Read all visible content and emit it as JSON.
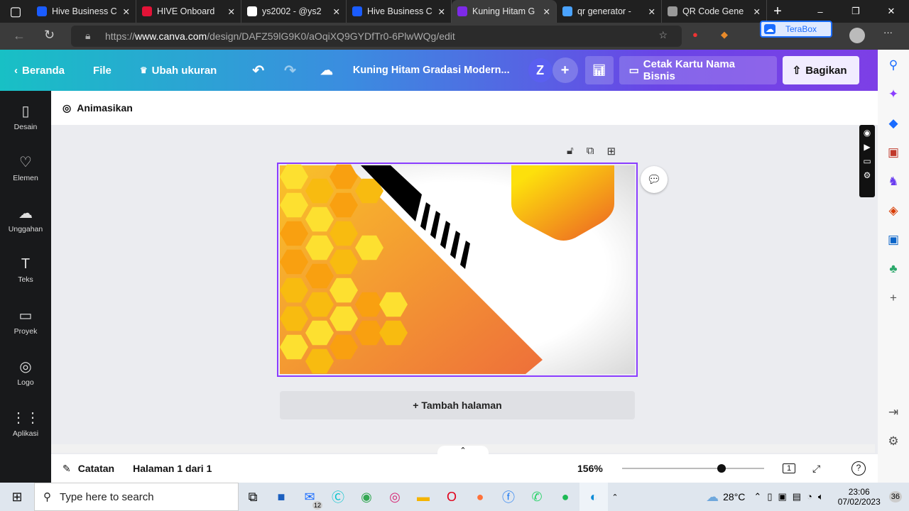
{
  "browser": {
    "tabs": [
      {
        "title": "Hive Business C",
        "color": "#1a5cff"
      },
      {
        "title": "HIVE Onboard",
        "color": "#e31337"
      },
      {
        "title": "ys2002 - @ys2",
        "color": "#ffffff"
      },
      {
        "title": "Hive Business C",
        "color": "#1a5cff"
      },
      {
        "title": "Kuning Hitam G",
        "color": "#7d2ae8",
        "active": true
      },
      {
        "title": "qr generator -",
        "color": "#4aa3ff"
      },
      {
        "title": "QR Code Gene",
        "color": "#999999"
      }
    ],
    "url_prefix": "https://",
    "url_domain": "www.canva.com",
    "url_path": "/design/DAFZ59lG9K0/aOqiXQ9GYDfTr0-6PlwWQg/edit",
    "terabox": "TeraBox"
  },
  "header": {
    "home": "Beranda",
    "file": "File",
    "resize": "Ubah ukuran",
    "title": "Kuning Hitam Gradasi Modern...",
    "avatar": "Z",
    "print": "Cetak Kartu Nama Bisnis",
    "share": "Bagikan"
  },
  "sidebar": [
    {
      "label": "Desain",
      "icon": "▯"
    },
    {
      "label": "Elemen",
      "icon": "♡"
    },
    {
      "label": "Unggahan",
      "icon": "☁"
    },
    {
      "label": "Teks",
      "icon": "T"
    },
    {
      "label": "Proyek",
      "icon": "▭"
    },
    {
      "label": "Logo",
      "icon": "◎"
    },
    {
      "label": "Aplikasi",
      "icon": "⋮⋮"
    }
  ],
  "toolbar": {
    "animate": "Animasikan"
  },
  "canvas": {
    "add_page": "+ Tambah halaman"
  },
  "footer": {
    "notes": "Catatan",
    "page": "Halaman 1 dari 1",
    "zoom": "156%",
    "zoom_level": 0.7,
    "page_count": "1",
    "help": "?"
  },
  "taskbar": {
    "search": "Type here to search",
    "mail_badge": "12",
    "temp": "28°C",
    "time": "23:06",
    "date": "07/02/2023",
    "notif": "36"
  }
}
